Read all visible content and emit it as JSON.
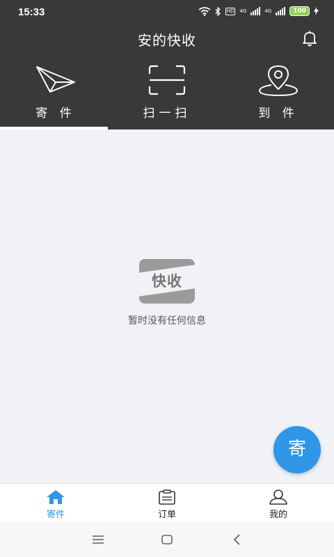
{
  "status_bar": {
    "time": "15:33",
    "network_1": "4G",
    "network_2": "4G",
    "battery": "100",
    "hd": "HD"
  },
  "app_bar": {
    "title": "安的快收"
  },
  "actions": [
    {
      "label": "寄 件",
      "icon": "paper-plane-icon"
    },
    {
      "label": "扫一扫",
      "icon": "scan-icon"
    },
    {
      "label": "到 件",
      "icon": "location-pin-icon"
    }
  ],
  "empty_state": {
    "logo_text": "快收",
    "message": "暂时没有任何信息"
  },
  "fab": {
    "label": "寄"
  },
  "bottom_nav": [
    {
      "label": "寄件",
      "icon": "home-icon",
      "active": true
    },
    {
      "label": "订单",
      "icon": "clipboard-icon",
      "active": false
    },
    {
      "label": "我的",
      "icon": "user-icon",
      "active": false
    }
  ],
  "colors": {
    "dark": "#3a393a",
    "accent": "#2f96e8",
    "background": "#f0f2f5"
  }
}
